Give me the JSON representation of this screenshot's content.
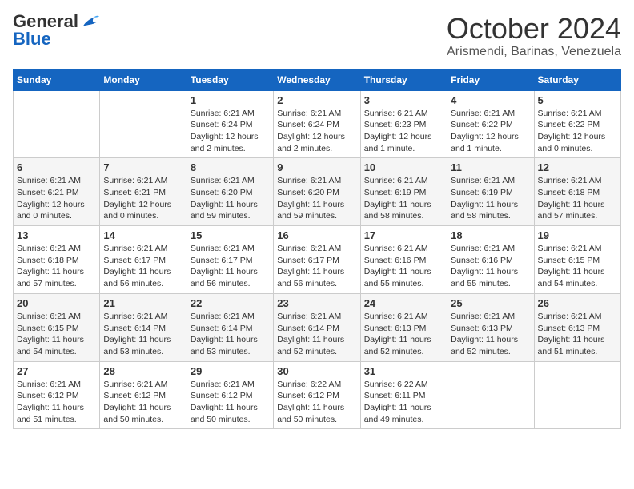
{
  "header": {
    "logo_general": "General",
    "logo_blue": "Blue",
    "month": "October 2024",
    "location": "Arismendi, Barinas, Venezuela"
  },
  "days_of_week": [
    "Sunday",
    "Monday",
    "Tuesday",
    "Wednesday",
    "Thursday",
    "Friday",
    "Saturday"
  ],
  "weeks": [
    [
      {
        "num": "",
        "info": ""
      },
      {
        "num": "",
        "info": ""
      },
      {
        "num": "1",
        "info": "Sunrise: 6:21 AM\nSunset: 6:24 PM\nDaylight: 12 hours and 2 minutes."
      },
      {
        "num": "2",
        "info": "Sunrise: 6:21 AM\nSunset: 6:24 PM\nDaylight: 12 hours and 2 minutes."
      },
      {
        "num": "3",
        "info": "Sunrise: 6:21 AM\nSunset: 6:23 PM\nDaylight: 12 hours and 1 minute."
      },
      {
        "num": "4",
        "info": "Sunrise: 6:21 AM\nSunset: 6:22 PM\nDaylight: 12 hours and 1 minute."
      },
      {
        "num": "5",
        "info": "Sunrise: 6:21 AM\nSunset: 6:22 PM\nDaylight: 12 hours and 0 minutes."
      }
    ],
    [
      {
        "num": "6",
        "info": "Sunrise: 6:21 AM\nSunset: 6:21 PM\nDaylight: 12 hours and 0 minutes."
      },
      {
        "num": "7",
        "info": "Sunrise: 6:21 AM\nSunset: 6:21 PM\nDaylight: 12 hours and 0 minutes."
      },
      {
        "num": "8",
        "info": "Sunrise: 6:21 AM\nSunset: 6:20 PM\nDaylight: 11 hours and 59 minutes."
      },
      {
        "num": "9",
        "info": "Sunrise: 6:21 AM\nSunset: 6:20 PM\nDaylight: 11 hours and 59 minutes."
      },
      {
        "num": "10",
        "info": "Sunrise: 6:21 AM\nSunset: 6:19 PM\nDaylight: 11 hours and 58 minutes."
      },
      {
        "num": "11",
        "info": "Sunrise: 6:21 AM\nSunset: 6:19 PM\nDaylight: 11 hours and 58 minutes."
      },
      {
        "num": "12",
        "info": "Sunrise: 6:21 AM\nSunset: 6:18 PM\nDaylight: 11 hours and 57 minutes."
      }
    ],
    [
      {
        "num": "13",
        "info": "Sunrise: 6:21 AM\nSunset: 6:18 PM\nDaylight: 11 hours and 57 minutes."
      },
      {
        "num": "14",
        "info": "Sunrise: 6:21 AM\nSunset: 6:17 PM\nDaylight: 11 hours and 56 minutes."
      },
      {
        "num": "15",
        "info": "Sunrise: 6:21 AM\nSunset: 6:17 PM\nDaylight: 11 hours and 56 minutes."
      },
      {
        "num": "16",
        "info": "Sunrise: 6:21 AM\nSunset: 6:17 PM\nDaylight: 11 hours and 56 minutes."
      },
      {
        "num": "17",
        "info": "Sunrise: 6:21 AM\nSunset: 6:16 PM\nDaylight: 11 hours and 55 minutes."
      },
      {
        "num": "18",
        "info": "Sunrise: 6:21 AM\nSunset: 6:16 PM\nDaylight: 11 hours and 55 minutes."
      },
      {
        "num": "19",
        "info": "Sunrise: 6:21 AM\nSunset: 6:15 PM\nDaylight: 11 hours and 54 minutes."
      }
    ],
    [
      {
        "num": "20",
        "info": "Sunrise: 6:21 AM\nSunset: 6:15 PM\nDaylight: 11 hours and 54 minutes."
      },
      {
        "num": "21",
        "info": "Sunrise: 6:21 AM\nSunset: 6:14 PM\nDaylight: 11 hours and 53 minutes."
      },
      {
        "num": "22",
        "info": "Sunrise: 6:21 AM\nSunset: 6:14 PM\nDaylight: 11 hours and 53 minutes."
      },
      {
        "num": "23",
        "info": "Sunrise: 6:21 AM\nSunset: 6:14 PM\nDaylight: 11 hours and 52 minutes."
      },
      {
        "num": "24",
        "info": "Sunrise: 6:21 AM\nSunset: 6:13 PM\nDaylight: 11 hours and 52 minutes."
      },
      {
        "num": "25",
        "info": "Sunrise: 6:21 AM\nSunset: 6:13 PM\nDaylight: 11 hours and 52 minutes."
      },
      {
        "num": "26",
        "info": "Sunrise: 6:21 AM\nSunset: 6:13 PM\nDaylight: 11 hours and 51 minutes."
      }
    ],
    [
      {
        "num": "27",
        "info": "Sunrise: 6:21 AM\nSunset: 6:12 PM\nDaylight: 11 hours and 51 minutes."
      },
      {
        "num": "28",
        "info": "Sunrise: 6:21 AM\nSunset: 6:12 PM\nDaylight: 11 hours and 50 minutes."
      },
      {
        "num": "29",
        "info": "Sunrise: 6:21 AM\nSunset: 6:12 PM\nDaylight: 11 hours and 50 minutes."
      },
      {
        "num": "30",
        "info": "Sunrise: 6:22 AM\nSunset: 6:12 PM\nDaylight: 11 hours and 50 minutes."
      },
      {
        "num": "31",
        "info": "Sunrise: 6:22 AM\nSunset: 6:11 PM\nDaylight: 11 hours and 49 minutes."
      },
      {
        "num": "",
        "info": ""
      },
      {
        "num": "",
        "info": ""
      }
    ]
  ]
}
